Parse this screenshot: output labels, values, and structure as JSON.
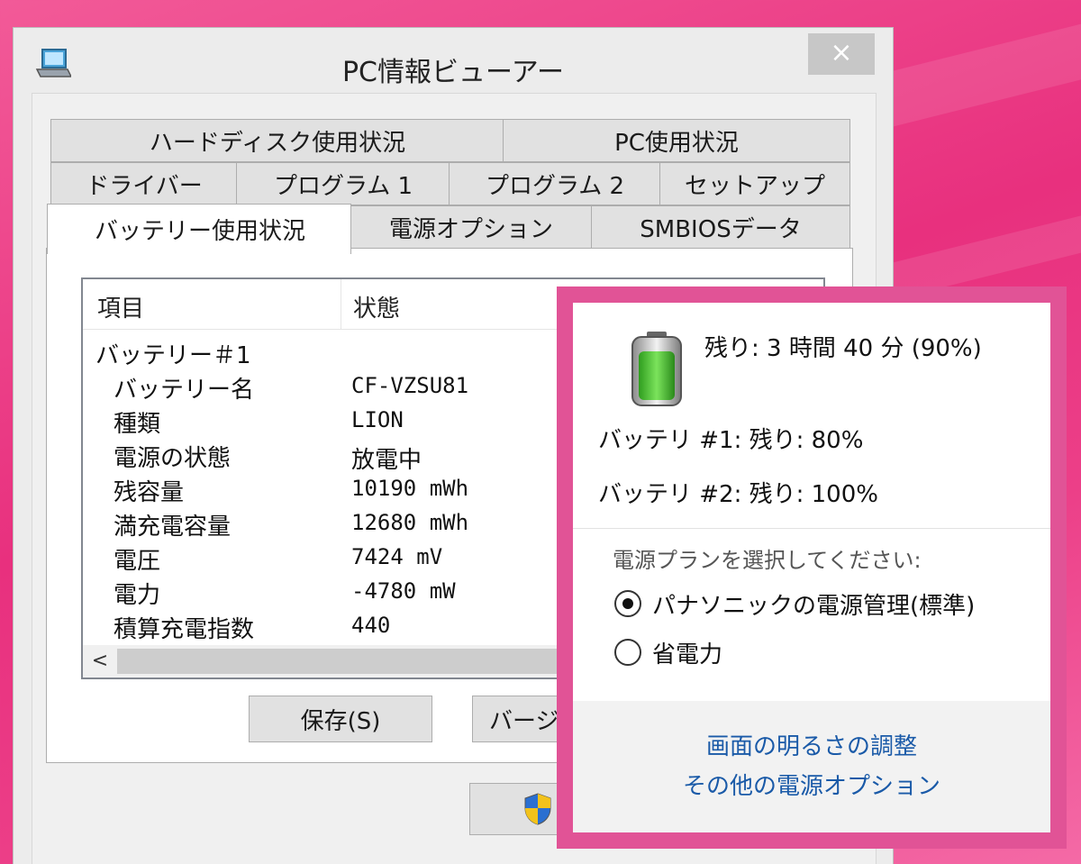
{
  "window": {
    "title": "PC情報ビューアー",
    "close_glyph": "×"
  },
  "tabs": {
    "row1": [
      "ハードディスク使用状況",
      "PC使用状況"
    ],
    "row2": [
      "ドライバー",
      "プログラム 1",
      "プログラム 2",
      "セットアップ"
    ],
    "row3": [
      "バッテリー使用状況",
      "電源オプション",
      "SMBIOSデータ"
    ],
    "active": "バッテリー使用状況"
  },
  "list": {
    "headers": [
      "項目",
      "状態"
    ],
    "group": "バッテリー＃1",
    "rows": [
      {
        "name": "バッテリー名",
        "value": "CF-VZSU81"
      },
      {
        "name": "種類",
        "value": "LION"
      },
      {
        "name": "電源の状態",
        "value": "放電中"
      },
      {
        "name": "残容量",
        "value": "10190 mWh"
      },
      {
        "name": "満充電容量",
        "value": "12680 mWh"
      },
      {
        "name": "電圧",
        "value": "7424 mV"
      },
      {
        "name": "電力",
        "value": "-4780 mW"
      },
      {
        "name": "積算充電指数",
        "value": "440"
      }
    ],
    "scroll_left_glyph": "<"
  },
  "buttons": {
    "save": "保存(S)",
    "version_partial": "バージ"
  },
  "flyout": {
    "remaining": "残り: 3 時間 40 分 (90%)",
    "battery1": "バッテリ #1: 残り: 80%",
    "battery2": "バッテリ #2: 残り: 100%",
    "plan_title": "電源プランを選択してください:",
    "plans": [
      {
        "label": "パナソニックの電源管理(標準)",
        "selected": true
      },
      {
        "label": "省電力",
        "selected": false
      }
    ],
    "links": [
      "画面の明るさの調整",
      "その他の電源オプション"
    ],
    "battery_level": 0.9
  },
  "colors": {
    "flyout_border": "#e15396",
    "link": "#1a5aa8",
    "battery_fill": "#3fbf2a"
  }
}
